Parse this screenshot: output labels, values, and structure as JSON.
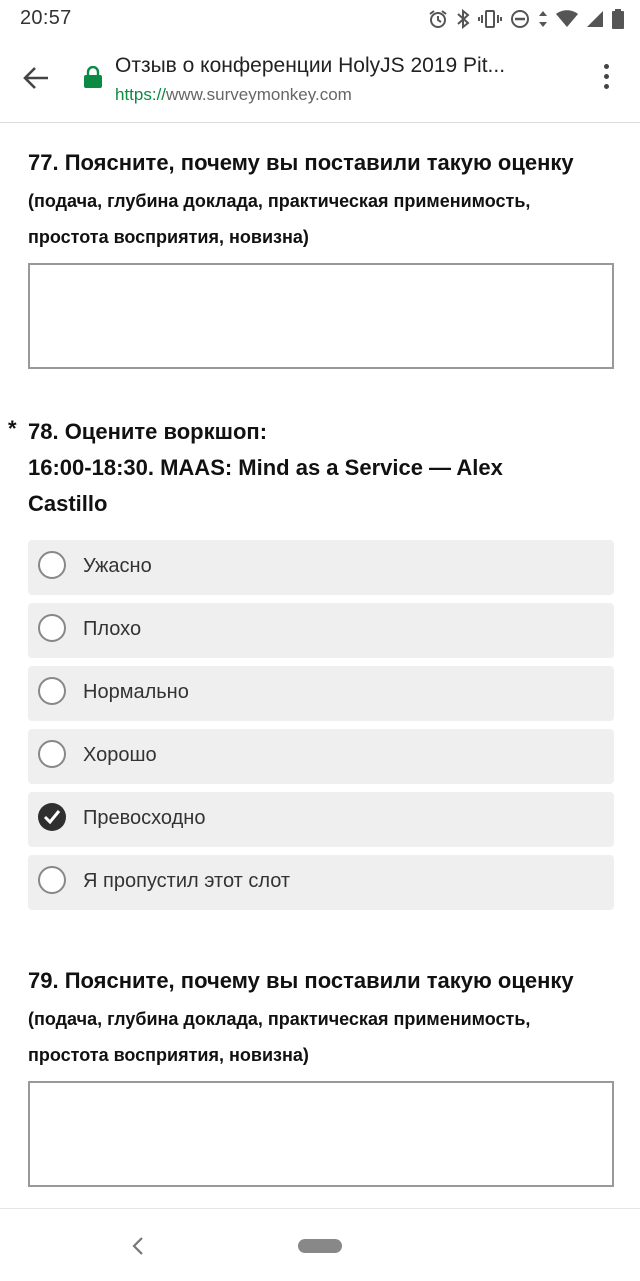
{
  "status_bar": {
    "time": "20:57",
    "icons": [
      "alarm-icon",
      "bluetooth-icon",
      "vibrate-icon",
      "do-not-disturb-icon",
      "data-arrows-icon",
      "wifi-icon",
      "signal-icon",
      "battery-icon"
    ]
  },
  "browser": {
    "title": "Отзыв о конференции HolyJS 2019 Pit...",
    "url_scheme": "https://",
    "url_host": "www.surveymonkey.com"
  },
  "q77": {
    "title": "77. Поясните, почему вы поставили такую оценку",
    "subtitle_line1": "(подача, глубина доклада, практическая применимость,",
    "subtitle_line2": "простота восприятия, новизна)",
    "answer": ""
  },
  "q78": {
    "required_mark": "*",
    "title_line1": "78. Оцените воркшоп:",
    "title_line2": "16:00-18:30. MAAS: Mind as a Service — Alex",
    "title_line3": "Castillo",
    "selected": "Превосходно",
    "options": [
      {
        "label": "Ужасно",
        "checked": false
      },
      {
        "label": "Плохо",
        "checked": false
      },
      {
        "label": "Нормально",
        "checked": false
      },
      {
        "label": "Хорошо",
        "checked": false
      },
      {
        "label": "Превосходно",
        "checked": true
      },
      {
        "label": "Я пропустил этот слот",
        "checked": false
      }
    ]
  },
  "q79": {
    "title": "79. Поясните, почему вы поставили такую оценку",
    "subtitle_line1": "(подача, глубина доклада, практическая применимость,",
    "subtitle_line2": "простота восприятия, новизна)",
    "answer": ""
  },
  "colors": {
    "lock_green": "#0b8a43",
    "option_bg": "#efefef",
    "checked_radio": "#2f2f2f"
  }
}
